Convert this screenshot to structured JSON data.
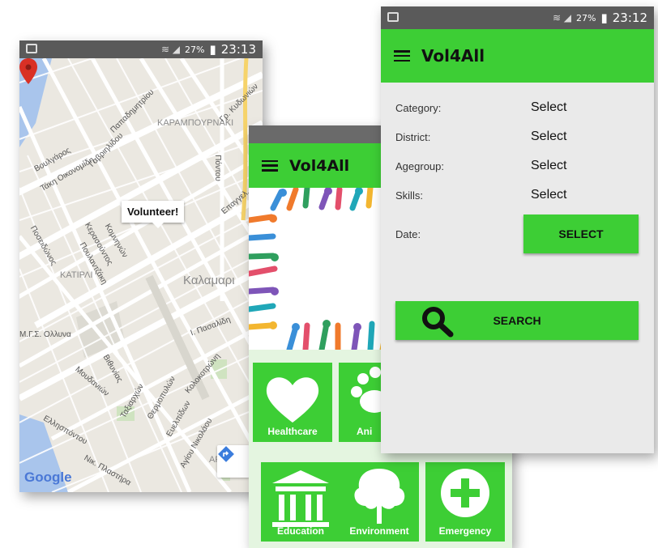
{
  "map_screen": {
    "status": {
      "battery": "27%",
      "time": "23:13"
    },
    "popup_label": "Volunteer!",
    "district_label": "Καλαμαρι",
    "area_label": "ΚΑΡΑΜΠΟΥΡΝΑΚΙ",
    "area_label_2": "ΚΑΤΙΡΛΙ",
    "area_label_3": "ΑΡΕ",
    "street_labels": [
      "Βουλγάρος",
      "Τάκη Οικονομίδη",
      "Γαβριηλίδου",
      "Παπαδημητρίου",
      "Ποσειδώνος",
      "Κερασούντος",
      "Πουλαντζάκη",
      "Κομνηνών",
      "Βιθυνίας",
      "Μουδανιών",
      "Ελλησπόντου",
      "Ευελπίδων",
      "Αγίου Νικολάου",
      "Νικ. Πλαστήρα",
      "Ι. Πασαλίδη",
      "Πόντου",
      "Θερμοπυλών",
      "Ταξιαρχών",
      "Κολοκοτρώνη",
      "Μ.Γ.Σ. Ολλυνα",
      "Επαγγελ.",
      "Γρ. Κυδωνιών"
    ],
    "logo": "Google"
  },
  "categories_screen": {
    "app_title": "Vol4All",
    "tiles": [
      {
        "label": "Healthcare",
        "icon": "heart-icon"
      },
      {
        "label": "Ani",
        "icon": "paw-icon"
      },
      {
        "label": "Education",
        "icon": "building-icon"
      },
      {
        "label": "Environment",
        "icon": "tree-icon"
      },
      {
        "label": "Emergency",
        "icon": "plus-icon"
      }
    ]
  },
  "search_screen": {
    "status": {
      "battery": "27%",
      "time": "23:12"
    },
    "app_title": "Vol4All",
    "fields": [
      {
        "label": "Category:",
        "value": "Select"
      },
      {
        "label": "District:",
        "value": "Select"
      },
      {
        "label": "Agegroup:",
        "value": "Select"
      },
      {
        "label": "Skills:",
        "value": "Select"
      }
    ],
    "date_label": "Date:",
    "select_button": "SELECT",
    "search_button": "SEARCH"
  },
  "colors": {
    "accent_green": "#3dce35",
    "statusbar": "#5a5a5a",
    "pin_red": "#d93025"
  }
}
